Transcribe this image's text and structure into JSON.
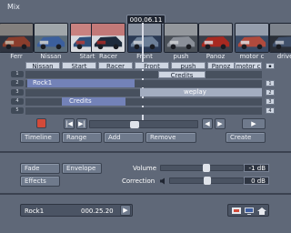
{
  "title": "Mix",
  "timecode": "000.06.11",
  "thumbnails": [
    {
      "label": "Ferr",
      "palette": [
        "#8a3d2c",
        "#c9c0b0",
        "#2f3440"
      ]
    },
    {
      "label": "Nissan",
      "palette": [
        "#3b5f9d",
        "#d9d7d2",
        "#5b6c7a"
      ]
    },
    {
      "label": "Start",
      "palette": [
        "#2d4f7a",
        "#bb3a33",
        "#d7d9de"
      ]
    },
    {
      "label": "Racer",
      "palette": [
        "#1d2a3b",
        "#b02a25",
        "#d7d9de"
      ]
    },
    {
      "label": "Front",
      "palette": [
        "#6c7f98",
        "#d4d7dc",
        "#2b3a55"
      ]
    },
    {
      "label": "push",
      "palette": [
        "#8a8f98",
        "#cfd2d6",
        "#4a5058"
      ]
    },
    {
      "label": "Panoz",
      "palette": [
        "#a82920",
        "#dfe2e6",
        "#3a3f49"
      ]
    },
    {
      "label": "motor c",
      "palette": [
        "#b04a3d",
        "#e0e3e8",
        "#3a4b66"
      ]
    },
    {
      "label": "driver",
      "palette": [
        "#40506a",
        "#c0c6cf",
        "#2a2f38"
      ]
    }
  ],
  "tags": [
    "Nissan",
    "Start",
    "Racer",
    "Front",
    "push",
    "Panoz",
    "motor c"
  ],
  "track_labels": [
    "1",
    "2",
    "3",
    "4",
    "5"
  ],
  "track_end_labels": [
    "1",
    "2",
    "3",
    "4",
    "5"
  ],
  "clips": {
    "credits_top": "Credits",
    "rock": "Rock1",
    "weplay": "weplay",
    "credits_lower": "Credits"
  },
  "buttons": {
    "timeline": "Timeline",
    "range": "Range",
    "add": "Add",
    "remove": "Remove",
    "create": "Create",
    "fade": "Fade",
    "envelope": "Envelope",
    "effects": "Effects"
  },
  "nav": {
    "prev_start": "|◀",
    "next_start": "▶|",
    "prev": "◀",
    "next": "▶",
    "play": "▶"
  },
  "volume": {
    "label": "Volume",
    "value": "-1 dB",
    "level": 0.55
  },
  "correction": {
    "label": "Correction",
    "value": "0 dB",
    "level": 0.5
  },
  "footer": {
    "clip": "Rock1",
    "time": "000.25.20",
    "play": "▶"
  },
  "icons": [
    "record-indicator-icon",
    "arrow-icon",
    "monitor-icon",
    "home-icon"
  ],
  "colors": {
    "background": "#5f6878",
    "record": "#d34a39",
    "clip_blue": "#7382b8"
  }
}
